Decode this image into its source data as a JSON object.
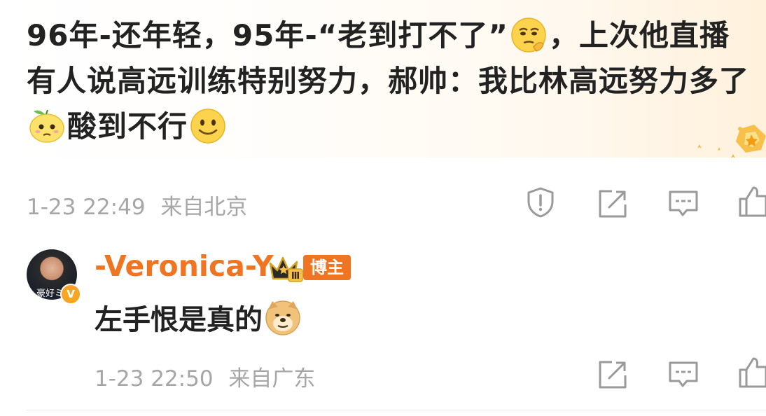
{
  "post": {
    "text_part1": "96年-还年轻，95年-“老到打不了”",
    "text_part2": "，上次他直播有人说高远训练特别努力，郝帅：我比林高远努力多了",
    "text_part3": "酸到不行",
    "emoji_1": "thinking-face-icon",
    "emoji_2": "lemon-face-icon",
    "emoji_3": "smile-face-icon",
    "timestamp": "1-23 22:49",
    "source": "来自北京"
  },
  "reply": {
    "username": "-Veronica-Y",
    "tag": "博主",
    "crown_level": "Ⅲ",
    "avatar_caption": "豪好ミ",
    "verified_mark": "V",
    "text": "左手恨是真的",
    "emoji": "doge-icon",
    "timestamp": "1-23 22:50",
    "source": "来自广东"
  },
  "colors": {
    "accent": "#f07522",
    "meta_gray": "#a6a6a6",
    "icon_gray": "#9a9a9a"
  }
}
